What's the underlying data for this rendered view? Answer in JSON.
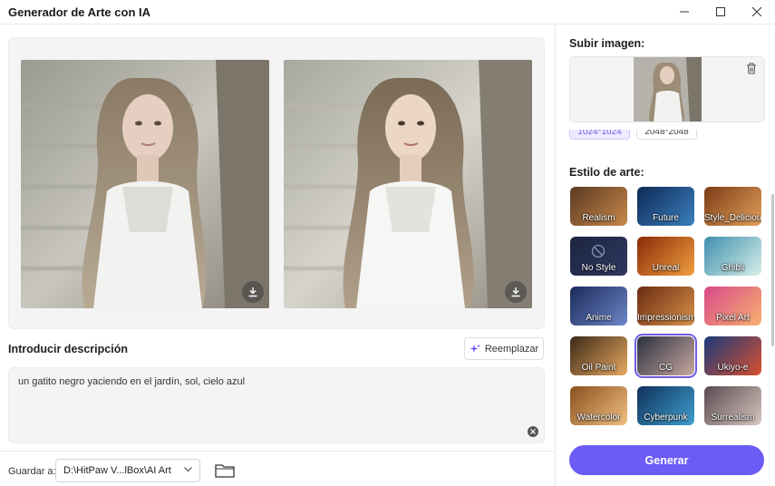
{
  "window": {
    "title": "Generador de Arte con IA"
  },
  "left": {
    "description_title": "Introducir descripción",
    "replace_label": "Reemplazar",
    "description_text": "un gatito negro yaciendo en el jardín, sol, cielo azul",
    "save_label": "Guardar a:",
    "save_path": "D:\\HitPaw V...lBox\\AI Art"
  },
  "right": {
    "upload_title": "Subir imagen:",
    "resolutions": [
      "1024*1024",
      "2048*2048"
    ],
    "style_title": "Estilo de arte:",
    "styles": [
      {
        "label": "Realism",
        "c1": "#5a3a22",
        "c2": "#c9884a"
      },
      {
        "label": "Future",
        "c1": "#0e2a55",
        "c2": "#3b7fbf"
      },
      {
        "label": "Style_Delicious",
        "c1": "#7a3b16",
        "c2": "#e3a15a"
      },
      {
        "label": "No Style",
        "c1": "#1d2440",
        "c2": "#2e3860"
      },
      {
        "label": "Unreal",
        "c1": "#8a2a08",
        "c2": "#f0a040"
      },
      {
        "label": "Ghibli",
        "c1": "#3f8fb0",
        "c2": "#d8efe8"
      },
      {
        "label": "Anime",
        "c1": "#1b2a5a",
        "c2": "#6d86c8"
      },
      {
        "label": "Impressionism",
        "c1": "#6a2a10",
        "c2": "#d8924a"
      },
      {
        "label": "Pixel Art",
        "c1": "#d84a8a",
        "c2": "#f8b070"
      },
      {
        "label": "Oil Paint",
        "c1": "#3a2a18",
        "c2": "#e8a860"
      },
      {
        "label": "CG",
        "c1": "#2a3040",
        "c2": "#c8a8a0"
      },
      {
        "label": "Ukiyo-e",
        "c1": "#1a3a7a",
        "c2": "#d85030"
      },
      {
        "label": "Watercolor",
        "c1": "#8a5020",
        "c2": "#f0c080"
      },
      {
        "label": "Cyberpunk",
        "c1": "#10305a",
        "c2": "#40a0d0"
      },
      {
        "label": "Surrealism",
        "c1": "#5a4a50",
        "c2": "#d8c8c0"
      }
    ],
    "generate_label": "Generar"
  },
  "colors": {
    "accent": "#6c5cf5",
    "panel_bg": "#f4f4f5"
  }
}
